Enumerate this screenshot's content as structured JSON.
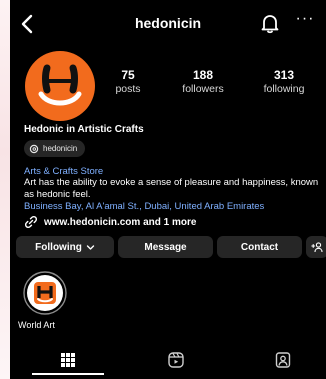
{
  "header": {
    "username": "hedonicin",
    "icons": [
      "chevron-left-icon",
      "bell-icon",
      "more-icon"
    ],
    "more_glyph": "···"
  },
  "stats": {
    "posts": {
      "value": "75",
      "label": "posts"
    },
    "followers": {
      "value": "188",
      "label": "followers"
    },
    "following": {
      "value": "313",
      "label": "following"
    }
  },
  "profile": {
    "name": "Hedonic in Artistic Crafts",
    "threads_handle": "hedonicin",
    "category": "Arts & Crafts Store",
    "bio": "Art has the ability to evoke a sense of pleasure and happiness, known as hedonic feel.",
    "location": "Business Bay, Al A'amal St., Dubai, United Arab Emirates",
    "link": "www.hedonicin.com and 1 more"
  },
  "buttons": {
    "following": "Following",
    "message": "Message",
    "contact": "Contact"
  },
  "highlights": [
    {
      "label": "World Art"
    }
  ],
  "tabs": [
    "grid-icon",
    "reels-icon",
    "tagged-icon"
  ],
  "colors": {
    "background": "#000000",
    "brand_orange": "#f26b1d",
    "link_blue": "#7fb0ff",
    "button_gray": "#262626"
  }
}
